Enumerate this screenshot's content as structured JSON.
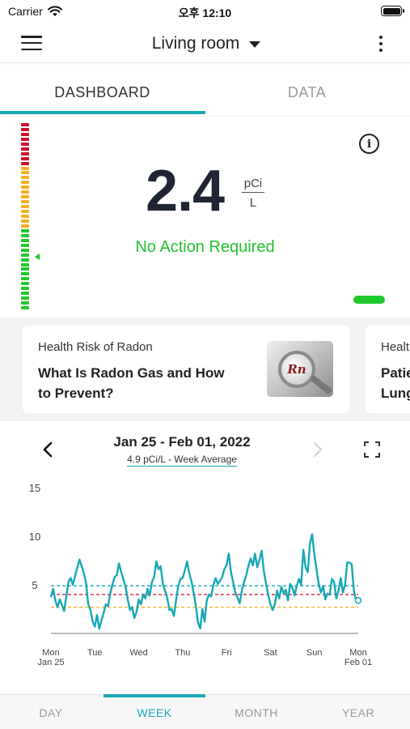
{
  "status_bar": {
    "carrier": "Carrier",
    "time": "오후 12:10"
  },
  "header": {
    "room": "Living room"
  },
  "tabs": [
    {
      "label": "DASHBOARD"
    },
    {
      "label": "DATA"
    }
  ],
  "reading": {
    "value": "2.4",
    "unit_top": "pCi",
    "unit_bottom": "L",
    "status": "No Action Required",
    "status_color": "#21c232"
  },
  "cards": [
    {
      "category": "Health Risk of Radon",
      "title": "What Is Radon Gas and How to Prevent?",
      "image_label": "Rn"
    },
    {
      "category": "Healt",
      "title": "Patie Lung"
    }
  ],
  "chart": {
    "date_range": "Jan 25 - Feb 01, 2022",
    "week_average": "4.9 pCi/L - Week Average"
  },
  "chart_data": {
    "type": "line",
    "title": "Jan 25 - Feb 01, 2022",
    "subtitle": "4.9 pCi/L - Week Average",
    "xlabel": "",
    "ylabel": "",
    "ylim": [
      0,
      15
    ],
    "xlim": [
      0,
      7
    ],
    "y_ticks": [
      "15",
      "10",
      "5"
    ],
    "x_ticks": [
      {
        "label": "Mon",
        "sub": "Jan 25"
      },
      {
        "label": "Tue",
        "sub": ""
      },
      {
        "label": "Wed",
        "sub": ""
      },
      {
        "label": "Thu",
        "sub": ""
      },
      {
        "label": "Fri",
        "sub": ""
      },
      {
        "label": "Sat",
        "sub": ""
      },
      {
        "label": "Sun",
        "sub": ""
      },
      {
        "label": "Mon",
        "sub": "Feb 01"
      }
    ],
    "reference_lines": [
      {
        "value": 4.9,
        "color": "#17a8b5",
        "style": "dashed"
      },
      {
        "value": 4.0,
        "color": "#c8102e",
        "style": "dashed"
      },
      {
        "value": 2.7,
        "color": "#f2b01e",
        "style": "dashed"
      }
    ],
    "series": [
      {
        "color": "#17a8b5",
        "x": [
          0,
          0.05,
          0.1,
          0.15,
          0.2,
          0.25,
          0.3,
          0.35,
          0.4,
          0.45,
          0.5,
          0.55,
          0.6,
          0.65,
          0.7,
          0.75,
          0.8,
          0.85,
          0.9,
          0.95,
          1.0,
          1.05,
          1.1,
          1.15,
          1.2,
          1.25,
          1.3,
          1.35,
          1.4,
          1.45,
          1.5,
          1.55,
          1.6,
          1.65,
          1.7,
          1.75,
          1.8,
          1.85,
          1.9,
          1.95,
          2.0,
          2.05,
          2.1,
          2.15,
          2.2,
          2.25,
          2.3,
          2.35,
          2.4,
          2.45,
          2.5,
          2.55,
          2.6,
          2.65,
          2.7,
          2.75,
          2.8,
          2.85,
          2.9,
          2.95,
          3.0,
          3.05,
          3.1,
          3.15,
          3.2,
          3.25,
          3.3,
          3.35,
          3.4,
          3.45,
          3.5,
          3.55,
          3.6,
          3.65,
          3.7,
          3.75,
          3.8,
          3.85,
          3.9,
          3.95,
          4.0,
          4.05,
          4.1,
          4.15,
          4.2,
          4.25,
          4.3,
          4.35,
          4.4,
          4.45,
          4.5,
          4.55,
          4.6,
          4.65,
          4.7,
          4.75,
          4.8,
          4.85,
          4.9,
          4.95,
          5.0,
          5.05,
          5.1,
          5.15,
          5.2,
          5.25,
          5.3,
          5.35,
          5.4,
          5.45,
          5.5,
          5.55,
          5.6,
          5.65,
          5.7,
          5.75,
          5.8,
          5.85,
          5.9,
          5.95,
          6.0,
          6.05,
          6.1,
          6.15,
          6.2,
          6.25,
          6.3,
          6.35,
          6.4,
          6.45,
          6.5,
          6.55,
          6.6,
          6.65,
          6.7,
          6.75,
          6.8,
          6.85,
          6.9,
          6.95,
          7.0
        ],
        "y": [
          3.8,
          4.6,
          3.4,
          2.7,
          3.5,
          2.9,
          2.3,
          3.8,
          5.3,
          5.7,
          5.0,
          5.9,
          6.8,
          7.6,
          6.9,
          6.2,
          5.2,
          3.0,
          2.4,
          1.2,
          0.7,
          1.9,
          0.5,
          1.3,
          2.1,
          3.0,
          2.8,
          4.1,
          5.0,
          5.8,
          6.0,
          7.2,
          6.3,
          5.6,
          4.8,
          3.5,
          2.4,
          2.7,
          1.6,
          2.2,
          3.5,
          3.0,
          4.0,
          3.6,
          4.6,
          3.9,
          5.3,
          5.8,
          7.4,
          6.6,
          6.9,
          5.1,
          4.4,
          3.6,
          2.4,
          2.5,
          1.8,
          3.4,
          4.9,
          5.6,
          5.7,
          6.5,
          7.4,
          6.2,
          5.4,
          4.2,
          2.9,
          1.1,
          0.5,
          2.5,
          1.2,
          3.4,
          4.0,
          3.8,
          5.0,
          5.7,
          5.1,
          5.4,
          5.8,
          6.6,
          7.0,
          8.2,
          6.3,
          5.3,
          4.2,
          3.7,
          3.1,
          4.4,
          5.3,
          6.0,
          7.0,
          7.7,
          7.0,
          8.2,
          6.8,
          7.6,
          8.5,
          6.4,
          5.1,
          4.0,
          3.0,
          2.4,
          3.0,
          4.4,
          3.6,
          4.8,
          4.1,
          4.5,
          3.4,
          5.1,
          4.7,
          3.9,
          4.9,
          5.6,
          5.0,
          8.6,
          6.8,
          6.3,
          9.3,
          10.2,
          8.1,
          6.6,
          5.1,
          4.2,
          4.9,
          3.5,
          4.1,
          4.0,
          5.6,
          5.3,
          3.6,
          4.4,
          5.7,
          4.2,
          5.0,
          7.3,
          7.3,
          7.1,
          4.4,
          3.4,
          3.4
        ]
      }
    ]
  },
  "periods": [
    {
      "label": "DAY"
    },
    {
      "label": "WEEK"
    },
    {
      "label": "MONTH"
    },
    {
      "label": "YEAR"
    }
  ],
  "colors": {
    "accent": "#17a8b5",
    "good": "#1fc92d",
    "warn": "#f2b01e",
    "danger": "#c8102e"
  },
  "icons": {
    "menu": "hamburger-icon",
    "dropdown": "caret-down-icon",
    "more": "more-vertical-icon",
    "info": "info-icon",
    "prev": "chevron-left-icon",
    "next": "chevron-right-icon",
    "expand": "expand-icon"
  }
}
